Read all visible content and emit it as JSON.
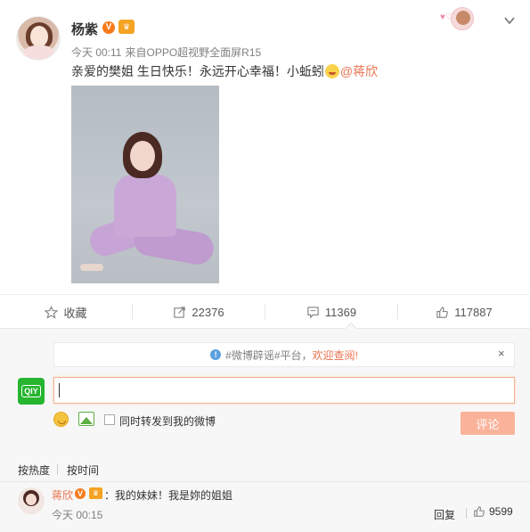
{
  "post": {
    "username": "杨紫",
    "v_badge": "V",
    "time": "今天 00:11",
    "source_prefix": "来自",
    "source": "OPPO超视野全面屏R15",
    "text_before": "亲爱的樊姐 生日快乐！永远开心幸福！小蚯蚓",
    "mention": "@蒋欣"
  },
  "actions": {
    "favorite_label": "收藏",
    "repost_count": "22376",
    "comment_count": "11369",
    "like_count": "117887"
  },
  "notice": {
    "text": "#微博辟谣#平台，",
    "highlight": "欢迎查阅!",
    "close": "×"
  },
  "composer": {
    "app_label": "QIY",
    "repost_checkbox_label": "同时转发到我的微博",
    "submit_label": "评论"
  },
  "tabs": {
    "by_hot": "按热度",
    "by_time": "按时间"
  },
  "comment": {
    "username": "蒋欣",
    "v_badge": "V",
    "text": "：我的妹妹！我是妳的姐姐",
    "time": "今天 00:15",
    "reply_label": "回复",
    "like_count": "9599"
  },
  "colors": {
    "accent": "#eb7350",
    "submit_disabled": "#fab39a",
    "iqiyi_green": "#25b52f"
  }
}
